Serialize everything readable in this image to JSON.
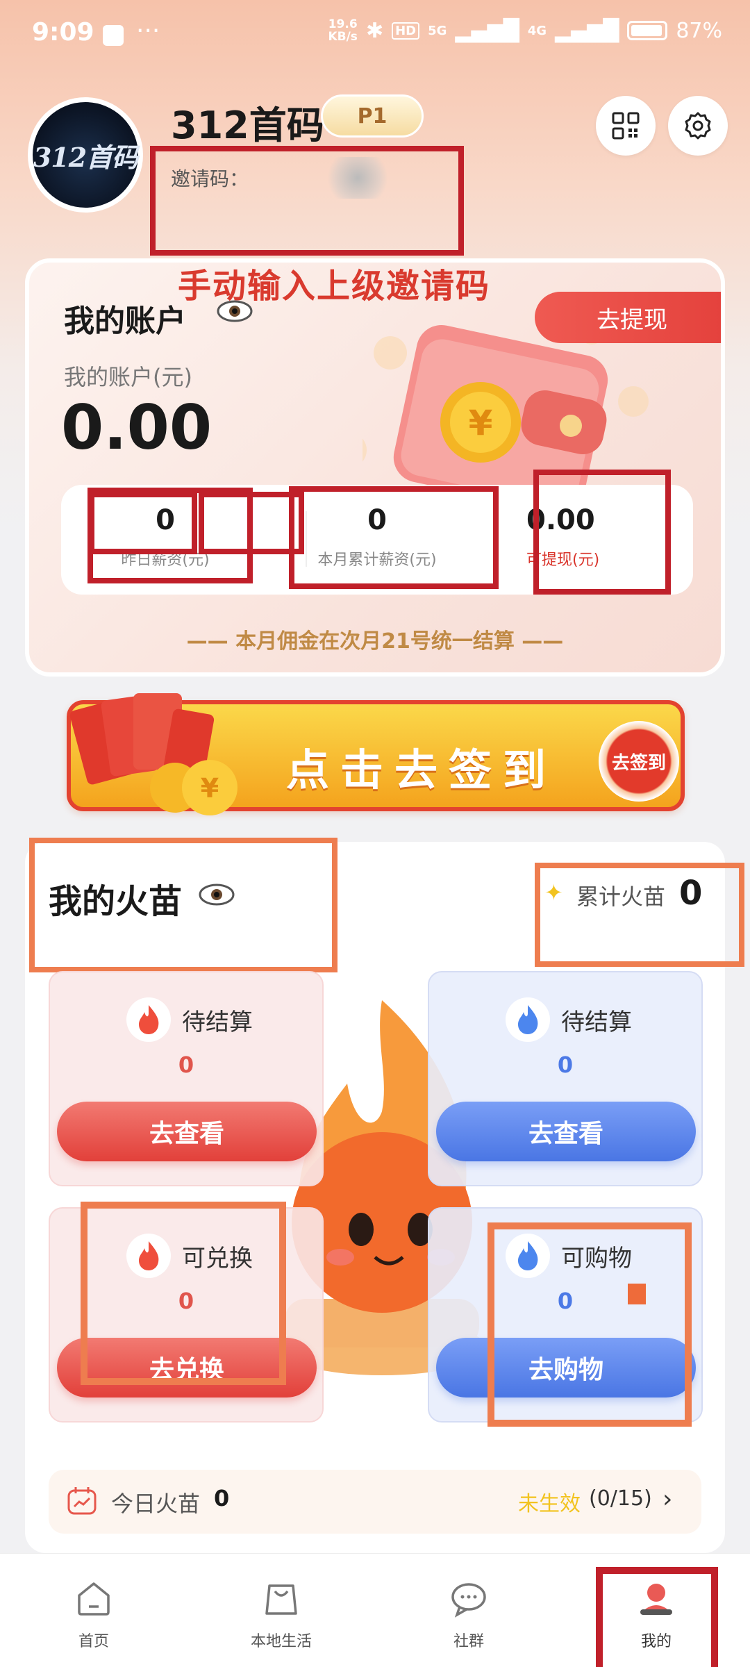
{
  "status_bar": {
    "time": "9:09",
    "dots": "···",
    "net_speed_top": "19.6",
    "net_speed_bottom": "KB/s",
    "hd": "HD",
    "sig1": "5G",
    "sig2": "4G",
    "battery": "87%"
  },
  "profile": {
    "avatar_text": "312首码",
    "name": "312首码",
    "level": "P1",
    "invite_label": "邀请码：",
    "annotation": "手动输入上级邀请码"
  },
  "account": {
    "title": "我的账户",
    "withdraw_button": "去提现",
    "balance_label": "我的账户(元)",
    "balance": "0.00",
    "stats": [
      {
        "value": "0",
        "label": "昨日薪资(元)"
      },
      {
        "value": "0",
        "label": "本月累计薪资(元)"
      },
      {
        "value": "0.00",
        "label": "可提现(元)"
      }
    ],
    "note": "—— 本月佣金在次月21号统一结算 ——"
  },
  "banner": {
    "text": "点击去签到",
    "button": "去签到"
  },
  "flames": {
    "title": "我的火苗",
    "cumulative_label": "累计火苗",
    "cumulative_value": "0",
    "tiles": [
      {
        "label": "待结算",
        "value": "0",
        "button": "去查看"
      },
      {
        "label": "待结算",
        "value": "0",
        "button": "去查看"
      },
      {
        "label": "可兑换",
        "value": "0",
        "button": "去兑换"
      },
      {
        "label": "可购物",
        "value": "0",
        "button": "去购物"
      }
    ],
    "today_label": "今日火苗",
    "today_value": "0",
    "today_status": "未生效",
    "today_count": "(0/15)"
  },
  "nav": [
    {
      "label": "首页"
    },
    {
      "label": "本地生活"
    },
    {
      "label": "社群"
    },
    {
      "label": "我的"
    }
  ],
  "colors": {
    "accent_red": "#e4413c",
    "accent_blue": "#4a76e4",
    "annotation_red": "#c0202a",
    "annotation_orange": "#ee7d4f"
  }
}
